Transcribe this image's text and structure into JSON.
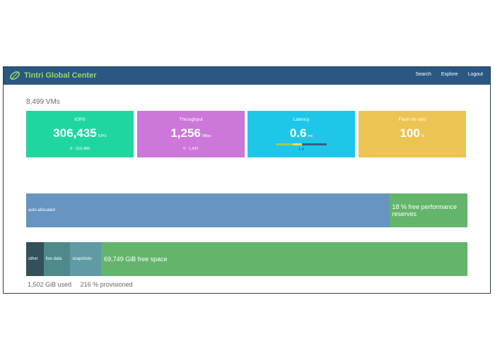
{
  "app": {
    "title": "Tintri Global Center",
    "logo_icon": "leaf-icon",
    "nav": [
      "Search",
      "Explore",
      "Logout"
    ]
  },
  "summary": {
    "vm_count": "8,499 VMs"
  },
  "tiles": [
    {
      "label": "IOPS",
      "value": "306,435",
      "unit": "IOPS",
      "range": "0 - 310,486",
      "color": "#20d6a0"
    },
    {
      "label": "Throughput",
      "value": "1,256",
      "unit": "MBps",
      "range": "0 - 1,647",
      "color": "#cc77d9"
    },
    {
      "label": "Latency",
      "value": "0.6",
      "unit": "ms",
      "range": "1.4",
      "color": "#1ec7ea"
    },
    {
      "label": "Flash hit ratio",
      "value": "100",
      "unit": "%",
      "range": "",
      "color": "#ecc453"
    }
  ],
  "performance": {
    "segments": [
      {
        "label": "auto-allocated",
        "share": 0.823,
        "color": "#6794c0"
      },
      {
        "label": "18 % free performance reserves",
        "share": 0.177,
        "color": "#62b56a"
      }
    ]
  },
  "space": {
    "segments": [
      {
        "label": "other",
        "share": 0.04,
        "color": "#34505a"
      },
      {
        "label": "live data",
        "share": 0.06,
        "color": "#4e8a8a"
      },
      {
        "label": "snapshots",
        "share": 0.07,
        "color": "#5f9aa5"
      },
      {
        "label": "69,749 GiB free space",
        "share": 0.83,
        "color": "#62b56a"
      }
    ],
    "used": "1,502 GiB used",
    "provisioned": "216 % provisioned"
  }
}
